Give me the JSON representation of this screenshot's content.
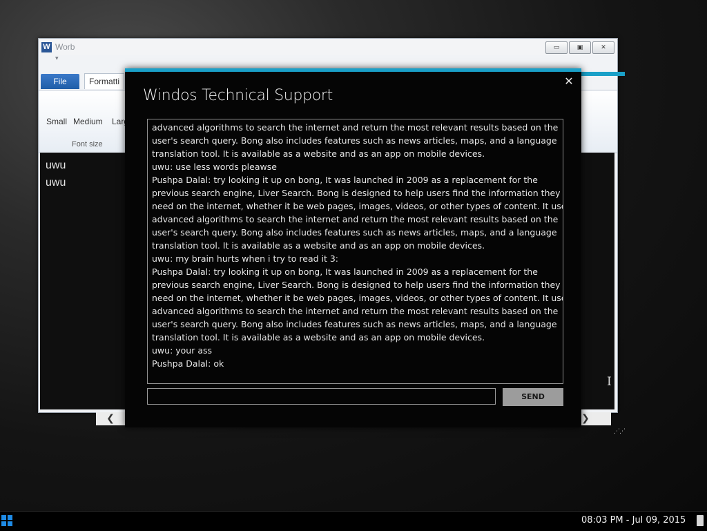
{
  "worb": {
    "title": "Worb",
    "app_icon": "W",
    "qat_symbol": "▾",
    "controls": {
      "minimize": "▭",
      "maximize": "▣",
      "close": "✕"
    },
    "tabs": {
      "file": "File",
      "formatting": "Formatti"
    },
    "ribbon": {
      "font_size_buttons": [
        "Small",
        "Medium",
        "Larg"
      ],
      "group_label": "Font size"
    },
    "document_lines": [
      "uwu",
      "uwu"
    ],
    "scroll": {
      "left": "❮",
      "right": "❯"
    },
    "accent_color": "#1aa0c8"
  },
  "support": {
    "title": "Windos Technical Support",
    "close_symbol": "✕",
    "chat_lines": [
      "advanced algorithms to search the internet and return the most relevant results based on the",
      "user's search query. Bong also includes features such as news articles, maps, and a language",
      "translation tool. It is available as a website and as an app on mobile devices.",
      "uwu: use less words pleawse",
      "Pushpa Dalal: try looking it up on bong, It was launched in 2009 as a replacement for the",
      "previous search engine, Liver Search. Bong is designed to help users find the information they",
      "need on the internet, whether it be web pages, images, videos, or other types of content. It uses",
      "advanced algorithms to search the internet and return the most relevant results based on the",
      "user's search query. Bong also includes features such as news articles, maps, and a language",
      "translation tool. It is available as a website and as an app on mobile devices.",
      "uwu: my brain hurts when i try to read it 3:",
      "Pushpa Dalal: try looking it up on bong, It was launched in 2009 as a replacement for the",
      "previous search engine, Liver Search. Bong is designed to help users find the information they",
      "need on the internet, whether it be web pages, images, videos, or other types of content. It uses",
      "advanced algorithms to search the internet and return the most relevant results based on the",
      "user's search query. Bong also includes features such as news articles, maps, and a language",
      "translation tool. It is available as a website and as an app on mobile devices.",
      "uwu: your ass",
      "Pushpa Dalal: ok"
    ],
    "input_value": "",
    "send_label": "SEND"
  },
  "taskbar": {
    "clock": "08:03 PM - Jul 09, 2015"
  },
  "icons": {
    "start": "windows-logo-icon",
    "text_cursor": "I"
  }
}
